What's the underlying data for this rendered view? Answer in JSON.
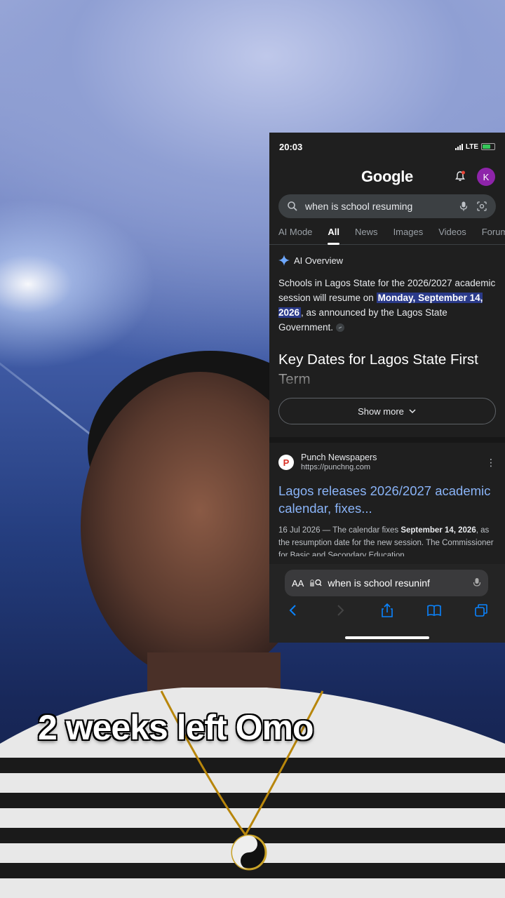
{
  "status_bar": {
    "time": "20:03",
    "network": "LTE"
  },
  "google": {
    "logo": "Google",
    "avatar_initial": "K",
    "search_query": "when is school resuming",
    "tabs": [
      {
        "label": "AI Mode",
        "active": false
      },
      {
        "label": "All",
        "active": true
      },
      {
        "label": "News",
        "active": false
      },
      {
        "label": "Images",
        "active": false
      },
      {
        "label": "Videos",
        "active": false
      },
      {
        "label": "Forums",
        "active": false
      }
    ],
    "ai_overview": {
      "title": "AI Overview",
      "text_before": "Schools in Lagos State for the 2026/2027 academic session will resume on ",
      "highlight": "Monday, September 14, 2026",
      "text_after": ", as announced by the Lagos State Government.",
      "heading": "Key Dates for Lagos State First Term",
      "show_more": "Show more"
    },
    "result": {
      "favicon_letter": "P",
      "source_name": "Punch Newspapers",
      "source_url": "https://punchng.com",
      "title": "Lagos releases 2026/2027 academic calendar, fixes...",
      "snippet_date": "16 Jul 2026 — The calendar fixes ",
      "snippet_bold": "September 14, 2026",
      "snippet_rest": ", as the resumption date for the new session. The Commissioner for Basic and Secondary Education"
    }
  },
  "safari": {
    "text_size_label": "AA",
    "address": "when is school resuninf"
  },
  "caption": "2 weeks left Omo",
  "colors": {
    "highlight_bg": "#2a3a8a",
    "link_blue": "#8ab4f8",
    "avatar": "#8e24aa",
    "favicon_red": "#d93025"
  }
}
